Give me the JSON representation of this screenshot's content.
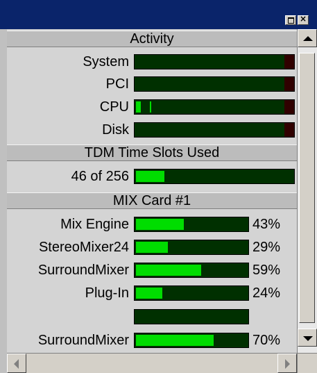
{
  "titlebar": {
    "maximize_label": "",
    "close_label": "×"
  },
  "activity": {
    "header": "Activity",
    "rows": [
      {
        "label": "System",
        "level": 0
      },
      {
        "label": "PCI",
        "level": 0
      },
      {
        "label": "CPU",
        "level": 0.03
      },
      {
        "label": "Disk",
        "level": 0
      }
    ]
  },
  "tdm": {
    "header": "TDM Time Slots Used",
    "value_text": "46 of 256",
    "used": 46,
    "total": 256
  },
  "mix": {
    "header": "MIX Card #1",
    "rows": [
      {
        "label": "Mix Engine",
        "percent_text": "43%",
        "level": 0.43
      },
      {
        "label": "StereoMixer24",
        "percent_text": "29%",
        "level": 0.29
      },
      {
        "label": "SurroundMixer",
        "percent_text": "59%",
        "level": 0.59
      },
      {
        "label": "Plug-In",
        "percent_text": "24%",
        "level": 0.24
      },
      {
        "label": "",
        "percent_text": "",
        "level": 0
      },
      {
        "label": "SurroundMixer",
        "percent_text": "70%",
        "level": 0.7
      }
    ]
  },
  "colors": {
    "meter_bg": "#003000",
    "meter_fill": "#00dd00",
    "meter_peak": "#300000",
    "title_bar": "#0a246a"
  }
}
